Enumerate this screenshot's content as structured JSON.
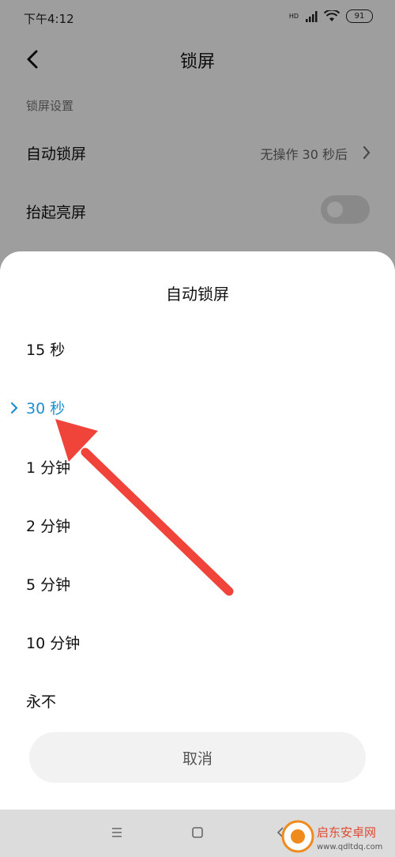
{
  "status_bar": {
    "time": "下午4:12",
    "hd": "HD",
    "battery": "91"
  },
  "header": {
    "title": "锁屏"
  },
  "section": {
    "label": "锁屏设置"
  },
  "settings": [
    {
      "label": "自动锁屏",
      "value": "无操作 30 秒后"
    },
    {
      "label": "抬起亮屏",
      "toggle": false
    }
  ],
  "sheet": {
    "title": "自动锁屏",
    "options": [
      {
        "label": "15 秒"
      },
      {
        "label": "30 秒",
        "selected": true
      },
      {
        "label": "1 分钟"
      },
      {
        "label": "2 分钟"
      },
      {
        "label": "5 分钟"
      },
      {
        "label": "10 分钟"
      },
      {
        "label": "永不"
      }
    ],
    "cancel_label": "取消"
  },
  "navbar": {
    "icons": [
      "menu-icon",
      "home-icon",
      "back-icon"
    ]
  },
  "watermark": {
    "text": "启东安卓网",
    "url": "www.qdltdq.com"
  },
  "colors": {
    "accent": "#1e8fd0",
    "arrow": "#f0433a",
    "scrim": "#000000"
  }
}
